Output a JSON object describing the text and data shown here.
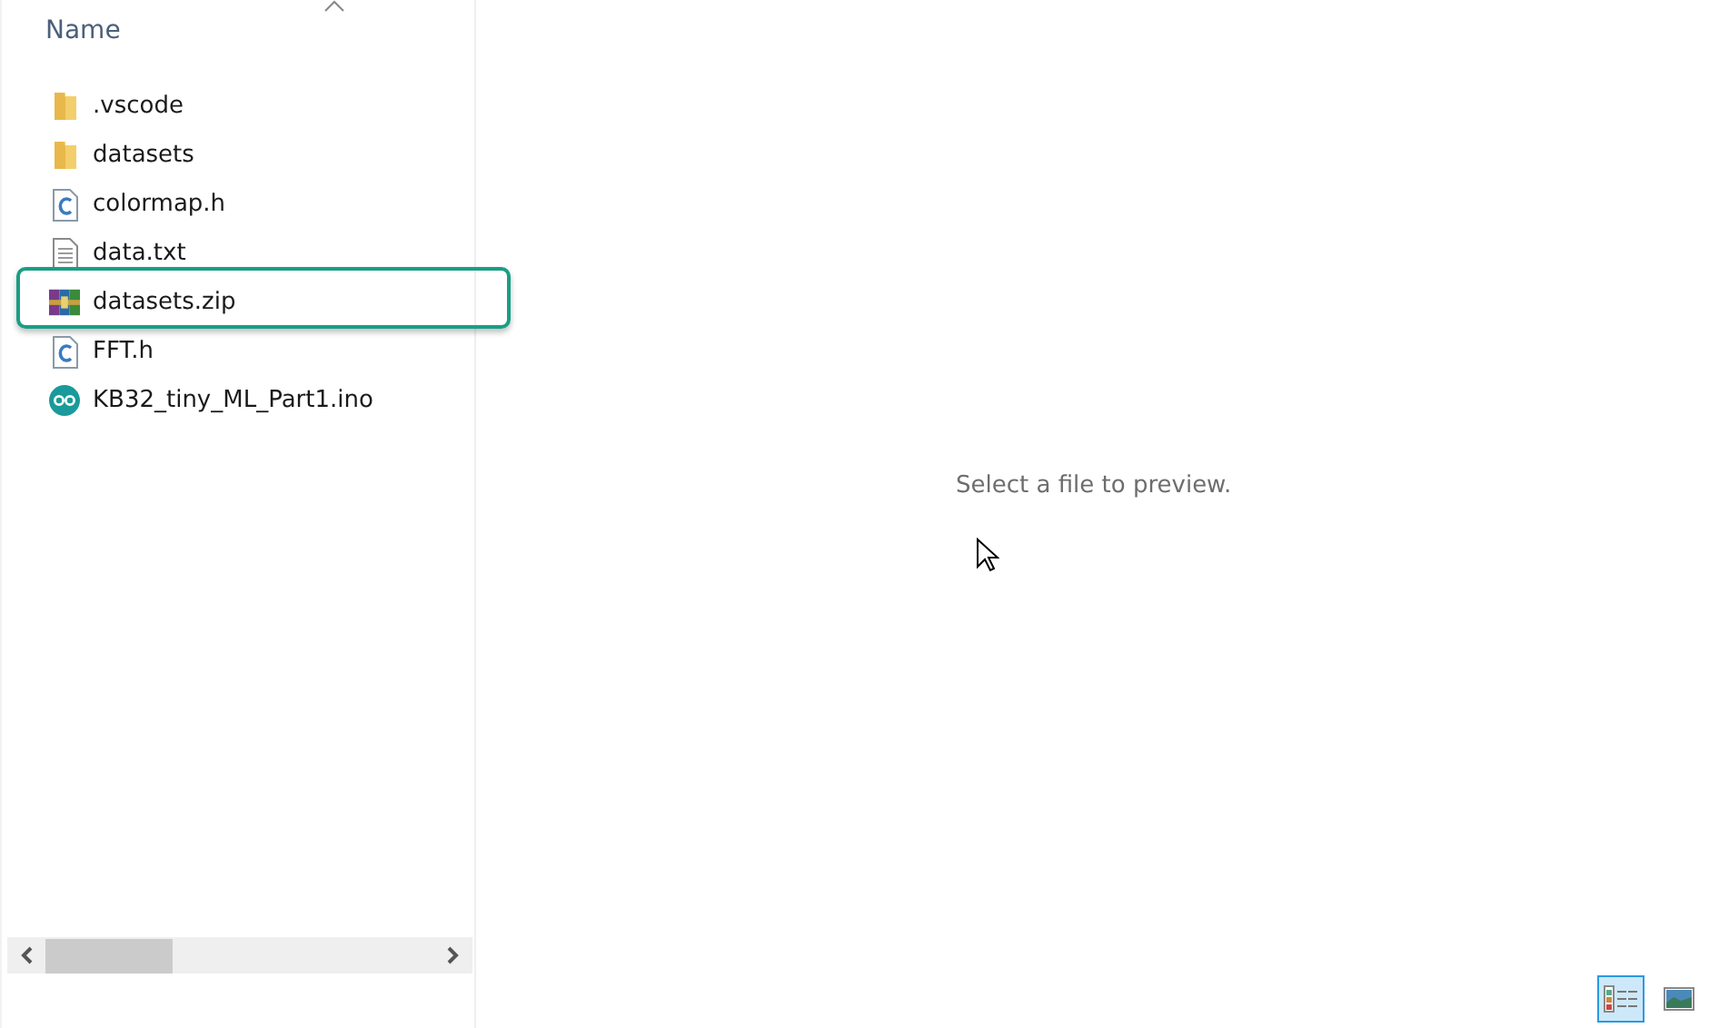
{
  "file_list": {
    "column_header": "Name",
    "sort_ascending": true,
    "files": [
      {
        "name": ".vscode",
        "kind": "folder",
        "highlighted": false
      },
      {
        "name": "datasets",
        "kind": "folder",
        "highlighted": false
      },
      {
        "name": "colormap.h",
        "kind": "c",
        "highlighted": false
      },
      {
        "name": "data.txt",
        "kind": "text",
        "highlighted": false
      },
      {
        "name": "datasets.zip",
        "kind": "archive",
        "highlighted": true
      },
      {
        "name": "FFT.h",
        "kind": "c",
        "highlighted": false
      },
      {
        "name": "KB32_tiny_ML_Part1.ino",
        "kind": "arduino",
        "highlighted": false
      }
    ]
  },
  "preview": {
    "message": "Select a file to preview."
  },
  "view_buttons": [
    {
      "kind": "details",
      "selected": true
    },
    {
      "kind": "large-icons",
      "selected": false
    }
  ]
}
